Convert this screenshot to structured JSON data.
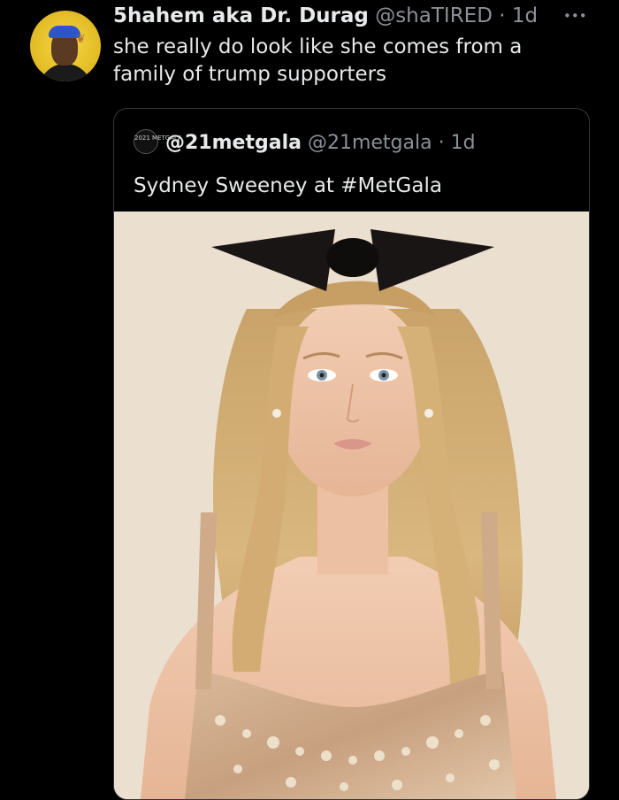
{
  "tweet": {
    "author_name": "5hahem aka Dr. Durag",
    "handle": "@shaTIRED",
    "separator": "·",
    "time": "1d",
    "text": "she really do look like she comes from a family of trump supporters",
    "more_icon": "more-horizontal-icon"
  },
  "quote": {
    "avatar_text": "2021 METGALA",
    "author_name": "@21metgala",
    "handle": "@21metgala",
    "separator": "·",
    "time": "1d",
    "text": "Sydney Sweeney at #MetGala",
    "image_icon": "photo-image"
  },
  "colors": {
    "background": "#000000",
    "primary_text": "#e7e9ea",
    "secondary_text": "#8b9096",
    "border": "#333639"
  }
}
